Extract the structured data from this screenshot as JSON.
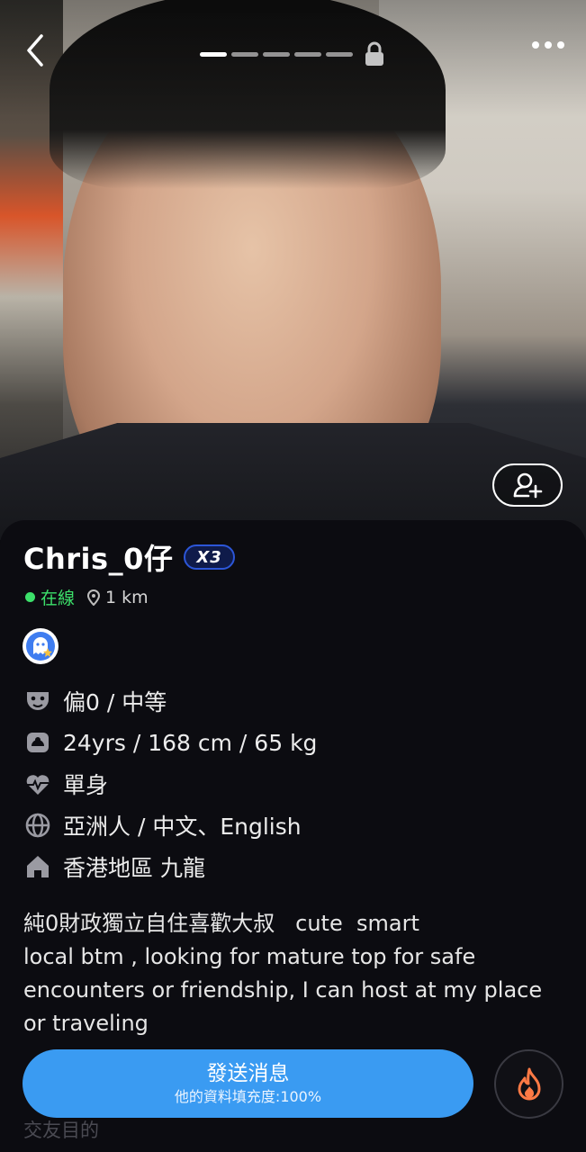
{
  "header": {
    "photo_count": 5,
    "active_photo_index": 0,
    "back_icon": "chevron-left-icon",
    "lock_icon": "lock-icon",
    "more_icon": "more-horizontal-icon",
    "follow_icon": "add-user-icon"
  },
  "profile": {
    "name": "Chris_0仔",
    "badge": "X3",
    "status": "在線",
    "distance": "1 km",
    "status_color": "#3ce06a"
  },
  "info": [
    {
      "icon": "mask-icon",
      "text": "偏0 / 中等"
    },
    {
      "icon": "body-stats-icon",
      "text": "24yrs / 168 cm / 65 kg"
    },
    {
      "icon": "heartbeat-icon",
      "text": "單身"
    },
    {
      "icon": "globe-icon",
      "text": "亞洲人 / 中文、English"
    },
    {
      "icon": "home-icon",
      "text": "香港地區 九龍"
    }
  ],
  "bio": "純0財政獨立自住喜歡大叔   cute  smart\nlocal btm , looking for mature top for safe\nencounters or friendship, I can host at my place\nor traveling",
  "next_section": "交友目的",
  "actions": {
    "send_label": "發送消息",
    "send_sub": "他的資料填充度:100%",
    "send_color": "#3a9bf2",
    "fire_icon": "flame-icon"
  }
}
